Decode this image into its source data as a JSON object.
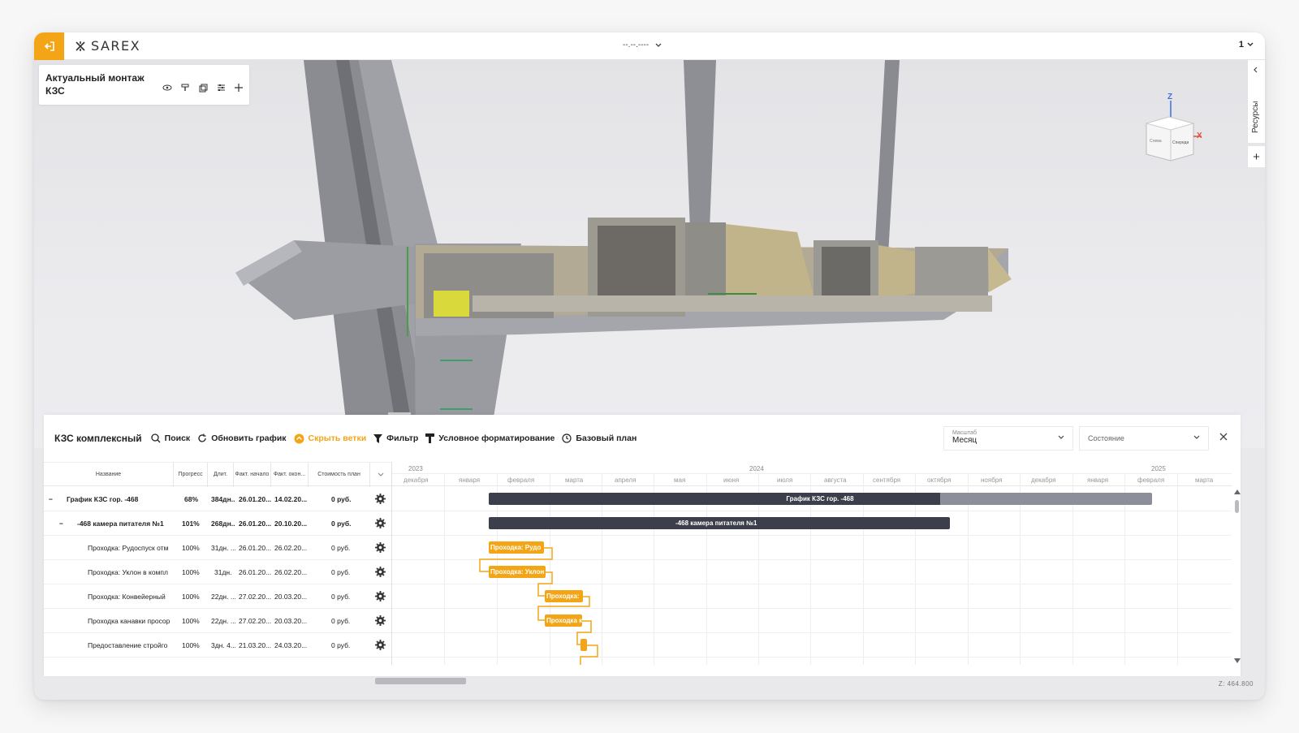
{
  "app": {
    "logo": "SAREX",
    "date_selector": "--.--.----",
    "page_selector": "1"
  },
  "model": {
    "title": "Актуальный монтаж КЗС"
  },
  "resources": {
    "label": "Ресурсы"
  },
  "viewcube": {
    "axis_z": "Z",
    "axis_x": "X",
    "face_left": "Слева",
    "face_front": "Спереди"
  },
  "schedule": {
    "title": "КЗС комплексный",
    "toolbar": {
      "search": "Поиск",
      "refresh": "Обновить график",
      "hide_branches": "Скрыть ветки",
      "filter": "Фильтр",
      "conditional": "Условное форматирование",
      "baseline": "Базовый план"
    },
    "scale": {
      "label": "Масштаб",
      "value": "Месяц"
    },
    "state": {
      "placeholder": "Состояние"
    },
    "columns": [
      "Название",
      "Прогресс",
      "Длит.",
      "Факт. начало",
      "Факт. окон...",
      "Стоимость план"
    ],
    "rows": [
      {
        "name": "График КЗС гор. -468",
        "progress": "68%",
        "dur": "384дн...",
        "start": "26.01.20...",
        "end": "14.02.20...",
        "cost": "0 руб."
      },
      {
        "name": "-468 камера питателя №1",
        "progress": "101%",
        "dur": "268дн...",
        "start": "26.01.20...",
        "end": "20.10.20...",
        "cost": "0 руб."
      },
      {
        "name": "Проходка: Рудоспуск отм",
        "progress": "100%",
        "dur": "31дн. ...",
        "start": "26.01.20...",
        "end": "26.02.20...",
        "cost": "0 руб."
      },
      {
        "name": "Проходка: Уклон в компл",
        "progress": "100%",
        "dur": "31дн.",
        "start": "26.01.20...",
        "end": "26.02.20...",
        "cost": "0 руб."
      },
      {
        "name": "Проходка: Конвейерный",
        "progress": "100%",
        "dur": "22дн. ...",
        "start": "27.02.20...",
        "end": "20.03.20...",
        "cost": "0 руб."
      },
      {
        "name": "Проходка канавки просор",
        "progress": "100%",
        "dur": "22дн. ...",
        "start": "27.02.20...",
        "end": "20.03.20...",
        "cost": "0 руб."
      },
      {
        "name": "Предоставление стройго",
        "progress": "100%",
        "dur": "3дн. 4...",
        "start": "21.03.20...",
        "end": "24.03.20...",
        "cost": "0 руб."
      }
    ],
    "gantt": {
      "years": [
        "2023",
        "2024",
        "2025"
      ],
      "months": [
        "декабря",
        "января",
        "февраля",
        "марта",
        "апреля",
        "мая",
        "июня",
        "июля",
        "августа",
        "сентября",
        "октября",
        "ноября",
        "декабря",
        "января",
        "февраля",
        "марта"
      ],
      "bar_labels": [
        "График КЗС гор. -468",
        "-468 камера питателя №1",
        "Проходка: Рудо",
        "Проходка: Уклон",
        "Проходка:",
        "Проходка к"
      ]
    }
  },
  "status": {
    "z": "Z: 464.800"
  }
}
